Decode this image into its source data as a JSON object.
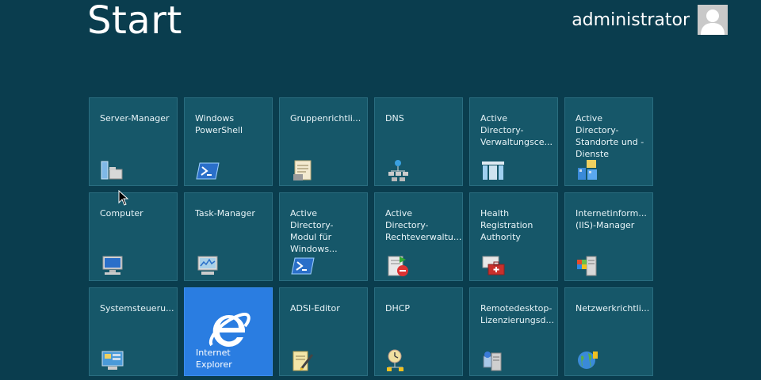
{
  "header": {
    "title": "Start",
    "user_name": "administrator"
  },
  "tiles": [
    {
      "label": "Server-Manager",
      "icon": "server-manager-icon"
    },
    {
      "label": "Windows\nPowerShell",
      "icon": "powershell-icon"
    },
    {
      "label": "Gruppenrichtli...",
      "icon": "group-policy-icon"
    },
    {
      "label": "DNS",
      "icon": "dns-icon"
    },
    {
      "label": "Active Directory-\nVerwaltungsce...",
      "icon": "ad-admin-center-icon"
    },
    {
      "label": "Active Directory-\nStandorte und -\nDienste",
      "icon": "ad-sites-icon"
    },
    {
      "label": "Computer",
      "icon": "computer-icon"
    },
    {
      "label": "Task-Manager",
      "icon": "task-manager-icon"
    },
    {
      "label": "Active Directory-\nModul für\nWindows...",
      "icon": "ad-powershell-icon"
    },
    {
      "label": "Active Directory-\nRechteverwaltu...",
      "icon": "ad-rights-icon"
    },
    {
      "label": "Health\nRegistration\nAuthority",
      "icon": "health-registration-icon"
    },
    {
      "label": "Internetinform...\n(IIS)-Manager",
      "icon": "iis-manager-icon"
    },
    {
      "label": "Systemsteueru...",
      "icon": "control-panel-icon"
    },
    {
      "label": "Internet Explorer",
      "icon": "internet-explorer-icon"
    },
    {
      "label": "ADSI-Editor",
      "icon": "adsi-editor-icon"
    },
    {
      "label": "DHCP",
      "icon": "dhcp-icon"
    },
    {
      "label": "Remotedesktop-\nLizenzierungsd...",
      "icon": "remote-desktop-licensing-icon"
    },
    {
      "label": "Netzwerkrichtli...",
      "icon": "network-policy-icon"
    }
  ],
  "colors": {
    "background": "#0a3d4e",
    "tile": "#165769",
    "ie_tile": "#2a7de1"
  }
}
